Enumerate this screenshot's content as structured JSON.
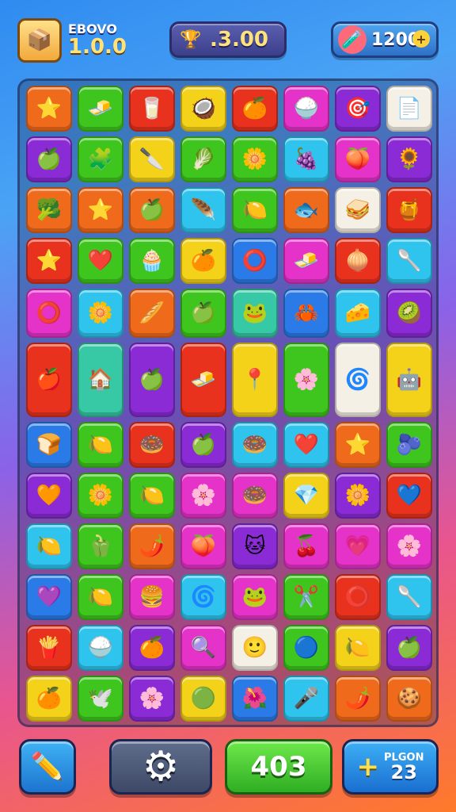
{
  "header": {
    "level_label": "EBOVO",
    "level_value": "1.0.0",
    "score_value": ".3.00",
    "coins_value": "1200",
    "plus_label": "+"
  },
  "footer": {
    "moves_value": "403",
    "bonus_label": "PLGON",
    "bonus_value": "23",
    "bonus_plus": "+"
  },
  "colors": {
    "red": "#e8321e",
    "green": "#3fc61e",
    "yellow": "#f5d21a",
    "purple": "#8a2bd6",
    "magenta": "#e532c8",
    "cyan": "#2fc4ee",
    "orange": "#f06a1c",
    "blue": "#2a7be8",
    "white": "#f4f0e6",
    "teal": "#37c9a6"
  },
  "board": {
    "rows": [
      [
        {
          "c": "orange",
          "i": "⭐"
        },
        {
          "c": "green",
          "i": "🧈"
        },
        {
          "c": "red",
          "i": "🥛"
        },
        {
          "c": "yellow",
          "i": "🥥"
        },
        {
          "c": "red",
          "i": "🍊"
        },
        {
          "c": "magenta",
          "i": "🍚"
        },
        {
          "c": "purple",
          "i": "🎯"
        },
        {
          "c": "white",
          "i": "📄"
        }
      ],
      [
        {
          "c": "purple",
          "i": "🍏"
        },
        {
          "c": "green",
          "i": "🧩"
        },
        {
          "c": "yellow",
          "i": "🔪"
        },
        {
          "c": "green",
          "i": "🥬"
        },
        {
          "c": "green",
          "i": "🌼"
        },
        {
          "c": "cyan",
          "i": "🍇"
        },
        {
          "c": "magenta",
          "i": "🍑"
        },
        {
          "c": "purple",
          "i": "🌻"
        }
      ],
      [
        {
          "c": "orange",
          "i": "🥦"
        },
        {
          "c": "orange",
          "i": "⭐"
        },
        {
          "c": "orange",
          "i": "🍏"
        },
        {
          "c": "cyan",
          "i": "🪶"
        },
        {
          "c": "green",
          "i": "🍋"
        },
        {
          "c": "orange",
          "i": "🐟"
        },
        {
          "c": "white",
          "i": "🥪"
        },
        {
          "c": "red",
          "i": "🍯"
        }
      ],
      [
        {
          "c": "red",
          "i": "⭐"
        },
        {
          "c": "green",
          "i": "❤️"
        },
        {
          "c": "green",
          "i": "🧁"
        },
        {
          "c": "yellow",
          "i": "🍊"
        },
        {
          "c": "blue",
          "i": "⭕"
        },
        {
          "c": "magenta",
          "i": "🧈"
        },
        {
          "c": "red",
          "i": "🧅"
        },
        {
          "c": "cyan",
          "i": "🥄"
        }
      ],
      [
        {
          "c": "magenta",
          "i": "⭕"
        },
        {
          "c": "cyan",
          "i": "🌼"
        },
        {
          "c": "orange",
          "i": "🥖"
        },
        {
          "c": "green",
          "i": "🍏"
        },
        {
          "c": "teal",
          "i": "🐸"
        },
        {
          "c": "blue",
          "i": "🦀"
        },
        {
          "c": "cyan",
          "i": "🧀"
        },
        {
          "c": "purple",
          "i": "🥝"
        }
      ],
      [
        {
          "c": "red",
          "i": "🍎"
        },
        {
          "c": "teal",
          "i": "🏠"
        },
        {
          "c": "purple",
          "i": "🍏"
        },
        {
          "c": "red",
          "i": "🧈"
        },
        {
          "c": "yellow",
          "i": "📍"
        },
        {
          "c": "green",
          "i": "🌸"
        },
        {
          "c": "white",
          "i": "🌀"
        },
        {
          "c": "yellow",
          "i": "🤖"
        }
      ],
      [
        {
          "c": "blue",
          "i": "🍞"
        },
        {
          "c": "green",
          "i": "🍋"
        },
        {
          "c": "red",
          "i": "🍩"
        },
        {
          "c": "purple",
          "i": "🍏"
        },
        {
          "c": "cyan",
          "i": "🍩"
        },
        {
          "c": "cyan",
          "i": "❤️"
        },
        {
          "c": "orange",
          "i": "⭐"
        },
        {
          "c": "green",
          "i": "🫐"
        }
      ],
      [
        {
          "c": "purple",
          "i": "🧡"
        },
        {
          "c": "green",
          "i": "🌼"
        },
        {
          "c": "green",
          "i": "🍋"
        },
        {
          "c": "magenta",
          "i": "🌸"
        },
        {
          "c": "magenta",
          "i": "🍩"
        },
        {
          "c": "yellow",
          "i": "💎"
        },
        {
          "c": "purple",
          "i": "🌼"
        },
        {
          "c": "red",
          "i": "💙"
        }
      ],
      [
        {
          "c": "cyan",
          "i": "🍋"
        },
        {
          "c": "green",
          "i": "🫑"
        },
        {
          "c": "orange",
          "i": "🌶️"
        },
        {
          "c": "magenta",
          "i": "🍑"
        },
        {
          "c": "purple",
          "i": "🐱"
        },
        {
          "c": "magenta",
          "i": "🍒"
        },
        {
          "c": "magenta",
          "i": "💗"
        },
        {
          "c": "magenta",
          "i": "🌸"
        }
      ],
      [
        {
          "c": "blue",
          "i": "💜"
        },
        {
          "c": "green",
          "i": "🍋"
        },
        {
          "c": "magenta",
          "i": "🍔"
        },
        {
          "c": "cyan",
          "i": "🌀"
        },
        {
          "c": "magenta",
          "i": "🐸"
        },
        {
          "c": "green",
          "i": "✂️"
        },
        {
          "c": "red",
          "i": "⭕"
        },
        {
          "c": "cyan",
          "i": "🥄"
        }
      ],
      [
        {
          "c": "red",
          "i": "🍟"
        },
        {
          "c": "cyan",
          "i": "🍚"
        },
        {
          "c": "purple",
          "i": "🍊"
        },
        {
          "c": "magenta",
          "i": "🔍"
        },
        {
          "c": "white",
          "i": "🙂"
        },
        {
          "c": "green",
          "i": "🔵"
        },
        {
          "c": "yellow",
          "i": "🍋"
        },
        {
          "c": "purple",
          "i": "🍏"
        }
      ],
      [
        {
          "c": "yellow",
          "i": "🍊"
        },
        {
          "c": "green",
          "i": "🕊️"
        },
        {
          "c": "purple",
          "i": "🌸"
        },
        {
          "c": "yellow",
          "i": "🟢"
        },
        {
          "c": "blue",
          "i": "🌺"
        },
        {
          "c": "cyan",
          "i": "🎤"
        },
        {
          "c": "orange",
          "i": "🌶️"
        },
        {
          "c": "orange",
          "i": "🍪"
        }
      ]
    ]
  }
}
